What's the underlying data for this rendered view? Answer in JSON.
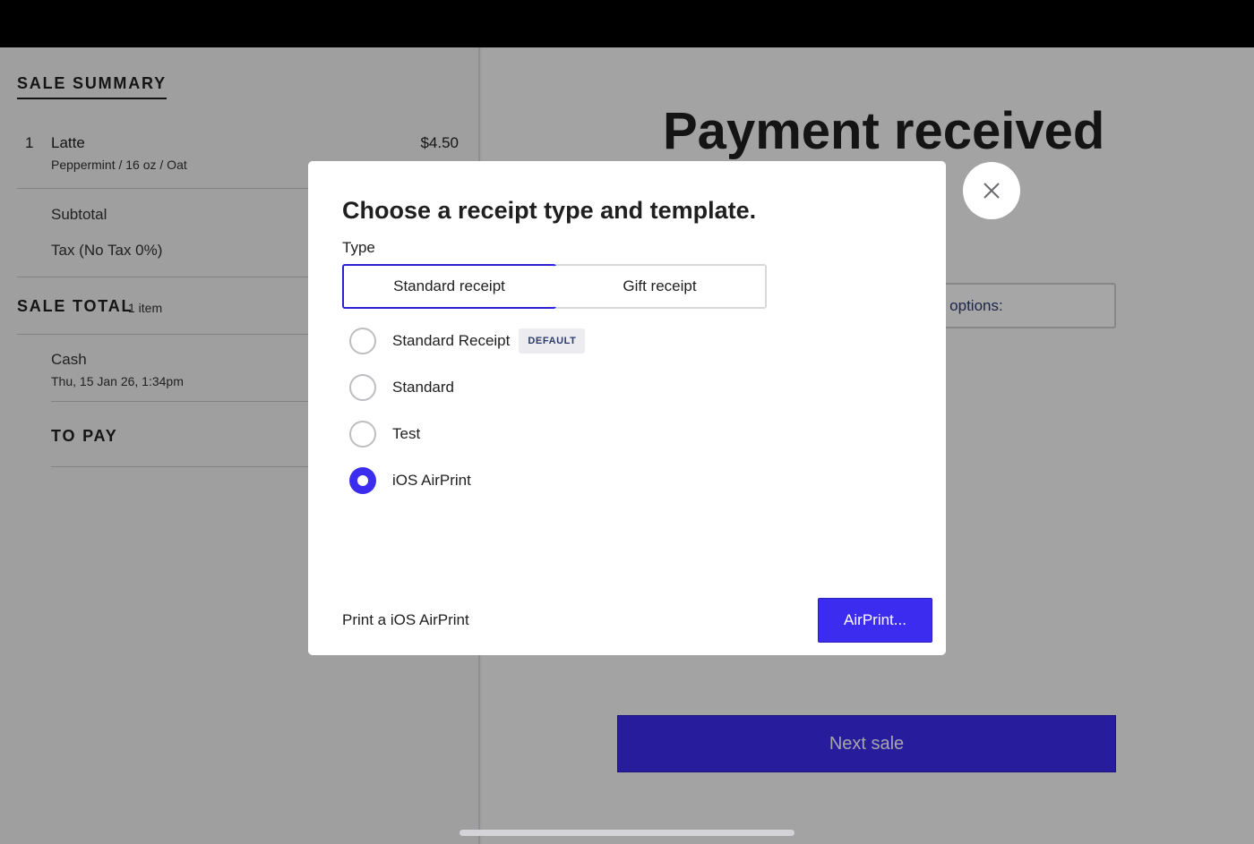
{
  "sale_summary": {
    "title": "SALE SUMMARY",
    "line_item": {
      "quantity": "1",
      "name": "Latte",
      "modifiers": "Peppermint / 16 oz / Oat",
      "price": "$4.50"
    },
    "subtotal_label": "Subtotal",
    "tax_label": "Tax (No Tax 0%)",
    "sale_total_label": "SALE TOTAL",
    "sale_total_count": "1 item",
    "payment": {
      "method": "Cash",
      "timestamp": "Thu, 15 Jan 26, 1:34pm"
    },
    "to_pay_label": "TO PAY"
  },
  "payment_screen": {
    "title": "Payment received",
    "options_text": "g options:",
    "next_sale_label": "Next sale"
  },
  "modal": {
    "title": "Choose a receipt type and template.",
    "type_label": "Type",
    "type_tabs": [
      {
        "label": "Standard receipt",
        "active": true
      },
      {
        "label": "Gift receipt",
        "active": false
      }
    ],
    "templates": [
      {
        "label": "Standard Receipt",
        "badge": "DEFAULT",
        "selected": false
      },
      {
        "label": "Standard",
        "selected": false
      },
      {
        "label": "Test",
        "selected": false
      },
      {
        "label": "iOS AirPrint",
        "selected": true
      }
    ],
    "footer_text": "Print a iOS AirPrint",
    "action_label": "AirPrint..."
  },
  "icons": {
    "close": "close-icon"
  },
  "colors": {
    "accent": "#3b2cf0",
    "overlay": "rgba(0,0,0,0.35)"
  }
}
